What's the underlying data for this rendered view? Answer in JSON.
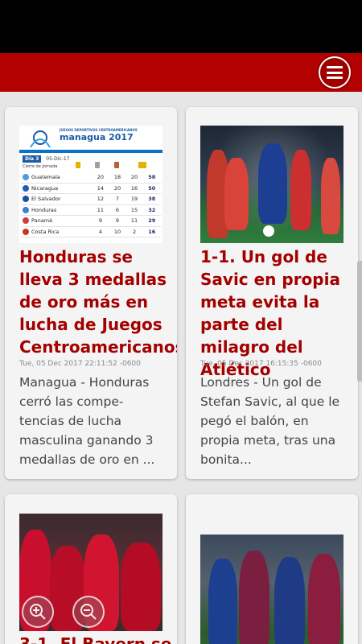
{
  "app": {
    "header_color": "#b30000",
    "menu_icon": "hamburger-menu-icon"
  },
  "articles": [
    {
      "title": "Honduras se lleva 3 medallas de oro más en lucha de Juegos Centroamericanos",
      "date": "Tue, 05 Dec 2017 22:11:52 -0600",
      "summary": "Managua - Honduras cerró las compe-tencias de lucha masculina ganando 3 medallas de oro en ...",
      "thumbnail": {
        "type": "medal-table",
        "logo_line1": "JUEGOS DEPORTIVOS CENTROAMERICANOS",
        "logo_line2": "managua 2017",
        "day_label": "Día 3",
        "day_date": "05-Dic-17",
        "subhead": "Cierre de Jornada",
        "rows": [
          {
            "country": "Guatemala",
            "gold": "20",
            "silver": "18",
            "bronze": "20",
            "total": "58",
            "flag": "#4f9be0"
          },
          {
            "country": "Nicaragua",
            "gold": "14",
            "silver": "20",
            "bronze": "16",
            "total": "50",
            "flag": "#1f5db5"
          },
          {
            "country": "El Salvador",
            "gold": "12",
            "silver": "7",
            "bronze": "19",
            "total": "38",
            "flag": "#1f4fa0"
          },
          {
            "country": "Honduras",
            "gold": "11",
            "silver": "6",
            "bronze": "15",
            "total": "32",
            "flag": "#3d7fd1"
          },
          {
            "country": "Panamá",
            "gold": "9",
            "silver": "9",
            "bronze": "11",
            "total": "29",
            "flag": "#d23a3a"
          },
          {
            "country": "Costa Rica",
            "gold": "4",
            "silver": "10",
            "bronze": "2",
            "total": "16",
            "flag": "#c0392b"
          }
        ]
      }
    },
    {
      "title": "1-1. Un gol de Savic en propia meta evita la parte del milagro del Atlético",
      "date": "Tue, 05 Dec 2017 16:15:35 -0600",
      "summary": "Londres - Un gol de Stefan Savic, al que le pegó el balón, en propia meta, tras una bonita...",
      "thumbnail": {
        "type": "photo",
        "icon": "soccer-match-photo"
      }
    },
    {
      "title": "3-1. El Bayern se",
      "thumbnail": {
        "type": "photo",
        "icon": "bayern-players-photo"
      }
    },
    {
      "title": "",
      "thumbnail": {
        "type": "photo",
        "icon": "barcelona-players-photo"
      }
    }
  ],
  "zoom": {
    "in_icon": "zoom-in-icon",
    "out_icon": "zoom-out-icon"
  }
}
